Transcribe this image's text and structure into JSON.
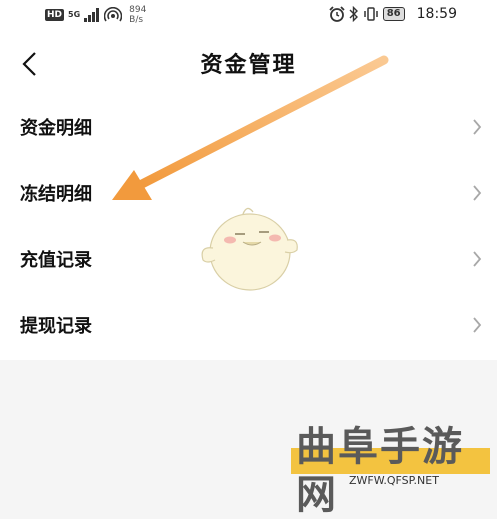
{
  "status_bar": {
    "hd_badge": "HD",
    "network_label": "5G",
    "speed_value": "894",
    "speed_unit": "B/s",
    "battery": "86",
    "time": "18:59"
  },
  "header": {
    "title": "资金管理"
  },
  "menu": {
    "items": [
      {
        "label": "资金明细"
      },
      {
        "label": "冻结明细"
      },
      {
        "label": "充值记录"
      },
      {
        "label": "提现记录"
      }
    ]
  },
  "annotation": {
    "arrow_color": "#f29a3d",
    "highlight_color": "#f3c340"
  },
  "watermark": {
    "brand": "曲阜手游网",
    "url": "ZWFW.QFSP.NET"
  }
}
